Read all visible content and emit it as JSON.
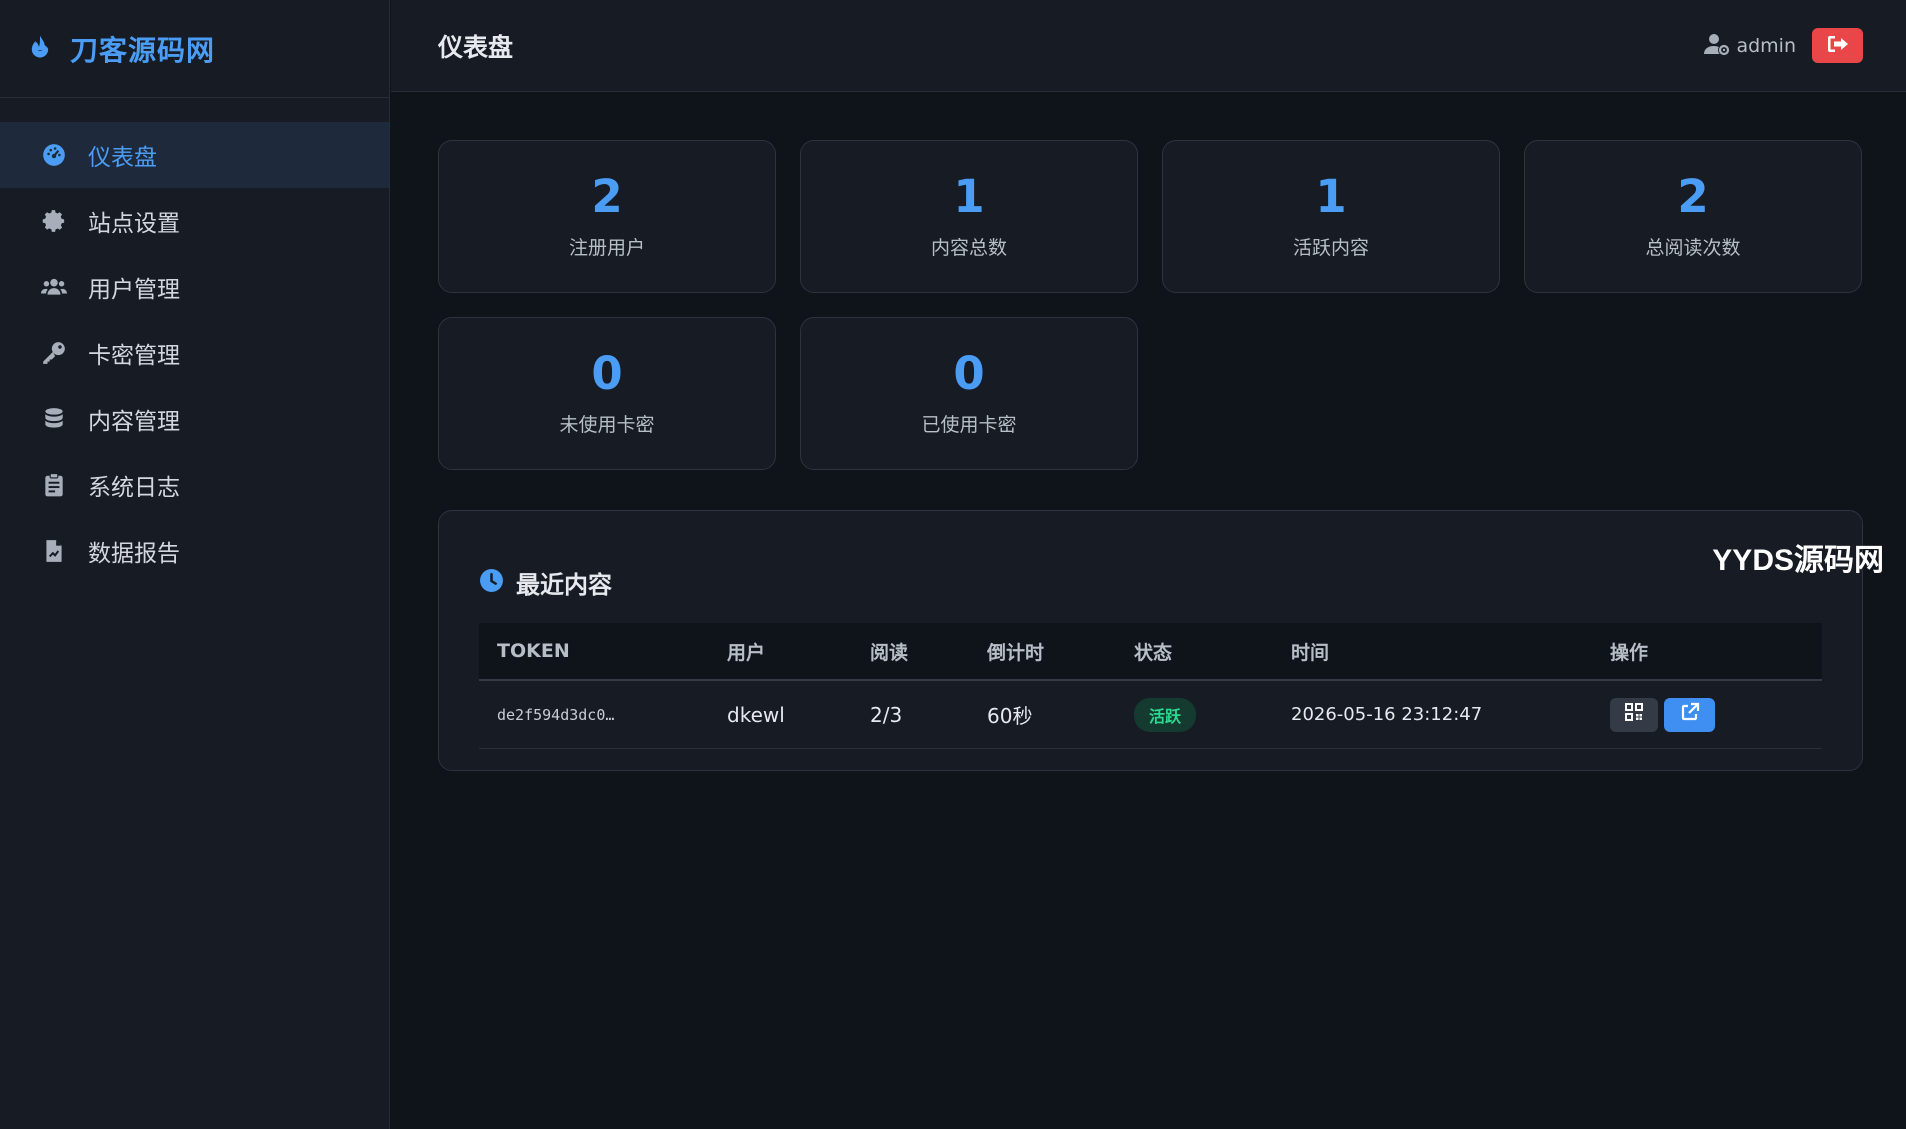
{
  "brand": {
    "name": "刀客源码网",
    "icon": "fire-icon"
  },
  "sidebar": {
    "items": [
      {
        "label": "仪表盘",
        "icon": "dashboard-icon",
        "active": true
      },
      {
        "label": "站点设置",
        "icon": "gear-icon"
      },
      {
        "label": "用户管理",
        "icon": "users-icon"
      },
      {
        "label": "卡密管理",
        "icon": "key-icon"
      },
      {
        "label": "内容管理",
        "icon": "database-icon"
      },
      {
        "label": "系统日志",
        "icon": "clipboard-icon"
      },
      {
        "label": "数据报告",
        "icon": "file-chart-icon"
      }
    ]
  },
  "header": {
    "title": "仪表盘",
    "user": "admin",
    "logout_icon": "logout-icon"
  },
  "stats": [
    {
      "value": "2",
      "label": "注册用户"
    },
    {
      "value": "1",
      "label": "内容总数"
    },
    {
      "value": "1",
      "label": "活跃内容"
    },
    {
      "value": "2",
      "label": "总阅读次数"
    },
    {
      "value": "0",
      "label": "未使用卡密"
    },
    {
      "value": "0",
      "label": "已使用卡密"
    }
  ],
  "recent": {
    "title": "最近内容",
    "watermark": "YYDS源码网",
    "columns": [
      "TOKEN",
      "用户",
      "阅读",
      "倒计时",
      "状态",
      "时间",
      "操作"
    ],
    "rows": [
      {
        "token": "de2f594d3dc0…",
        "user": "dkewl",
        "reads": "2/3",
        "countdown": "60秒",
        "status": "活跃",
        "time": "2026-05-16 23:12:47"
      }
    ]
  },
  "colors": {
    "accent": "#4a9cf5",
    "danger": "#e9464a",
    "success": "#2bd98f",
    "bg": "#0f131a",
    "panel": "#161b24"
  }
}
